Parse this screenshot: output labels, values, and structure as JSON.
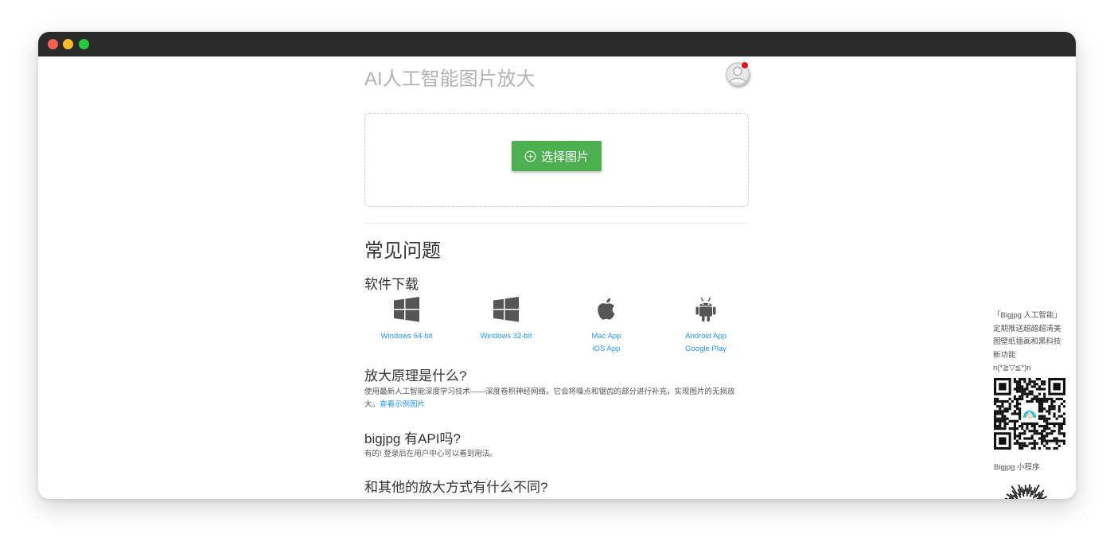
{
  "header": {
    "title": "AI人工智能图片放大"
  },
  "upload": {
    "button_label": "选择图片"
  },
  "faq": {
    "title": "常见问题",
    "download": {
      "heading": "软件下载",
      "items": [
        {
          "icon": "windows-icon",
          "links": [
            "Windows 64-bit"
          ]
        },
        {
          "icon": "windows-icon",
          "links": [
            "Windows 32-bit"
          ]
        },
        {
          "icon": "apple-icon",
          "links": [
            "Mac App",
            "iOS App"
          ]
        },
        {
          "icon": "android-icon",
          "links": [
            "Android App",
            "Google Play"
          ]
        }
      ]
    },
    "principle": {
      "heading": "放大原理是什么?",
      "text": "使用最新人工智能深度学习技术——深度卷积神经网络。它会将噪点和锯齿的部分进行补充，实现图片的无损放大。",
      "link": "查看示例图片"
    },
    "api": {
      "heading": "bigjpg 有API吗?",
      "text": "有的! 登录后在用户中心可以看到用法。"
    },
    "difference": {
      "heading": "和其他的放大方式有什么不同?"
    }
  },
  "sidebar": {
    "promo_lines": [
      "「Bigjpg 人工智能」",
      "定期推送超超超清美",
      "图壁纸插画和黑科技",
      "新功能",
      "n(*≧▽≦*)n"
    ],
    "miniprogram_label": "Bigjpg 小程序"
  },
  "colors": {
    "accent_green": "#4caf50",
    "link_blue": "#2196f3",
    "titlebar": "#2b2b2b",
    "notification": "#e0161c"
  }
}
